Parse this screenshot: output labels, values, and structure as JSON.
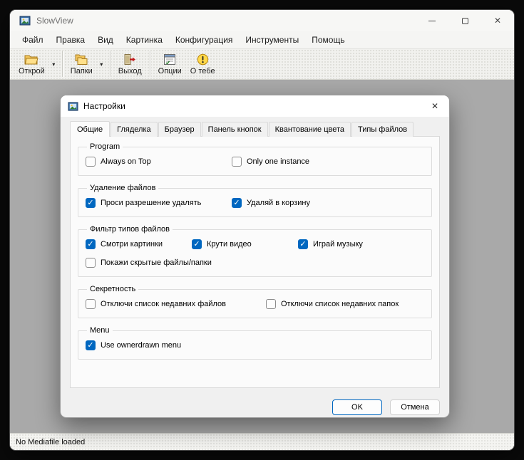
{
  "window": {
    "title": "SlowView",
    "controls": {
      "close": "✕"
    }
  },
  "menu": {
    "items": [
      "Файл",
      "Правка",
      "Вид",
      "Картинка",
      "Конфигурация",
      "Инструменты",
      "Помощь"
    ]
  },
  "toolbar": {
    "buttons": [
      {
        "label": "Открой",
        "icon": "open-folder-icon",
        "dropdown": true
      },
      {
        "label": "Папки",
        "icon": "folders-icon",
        "dropdown": true
      },
      {
        "label": "Выход",
        "icon": "exit-icon",
        "dropdown": false
      },
      {
        "label": "Опции",
        "icon": "options-icon",
        "dropdown": false
      },
      {
        "label": "О тебе",
        "icon": "about-icon",
        "dropdown": false
      }
    ],
    "dropdown_glyph": "▾"
  },
  "statusbar": {
    "text": "No Mediafile loaded"
  },
  "dialog": {
    "title": "Настройки",
    "close": "✕",
    "active_tab": 0,
    "tabs": [
      "Общие",
      "Гляделка",
      "Браузер",
      "Панель кнопок",
      "Квантование цвета",
      "Типы файлов"
    ],
    "groups": [
      {
        "title": "Program",
        "items": [
          {
            "label": "Always on Top",
            "checked": false
          },
          {
            "label": "Only one instance",
            "checked": false
          }
        ]
      },
      {
        "title": "Удаление файлов",
        "items": [
          {
            "label": "Проси разрешение удалять",
            "checked": true
          },
          {
            "label": "Удаляй в корзину",
            "checked": true
          }
        ]
      },
      {
        "title": "Фильтр типов файлов",
        "items": [
          {
            "label": "Смотри картинки",
            "checked": true
          },
          {
            "label": "Крути видео",
            "checked": true
          },
          {
            "label": "Играй музыку",
            "checked": true
          },
          {
            "label": "Покажи скрытые файлы/папки",
            "checked": false
          }
        ]
      },
      {
        "title": "Секретность",
        "items": [
          {
            "label": "Отключи список недавних файлов",
            "checked": false
          },
          {
            "label": "Отключи список недавних папок",
            "checked": false
          }
        ]
      },
      {
        "title": "Menu",
        "items": [
          {
            "label": "Use ownerdrawn menu",
            "checked": true
          }
        ]
      }
    ],
    "buttons": {
      "ok": "OK",
      "cancel": "Отмена"
    }
  },
  "colors": {
    "accent": "#0067c0",
    "client_bg": "#a9a9a9"
  }
}
